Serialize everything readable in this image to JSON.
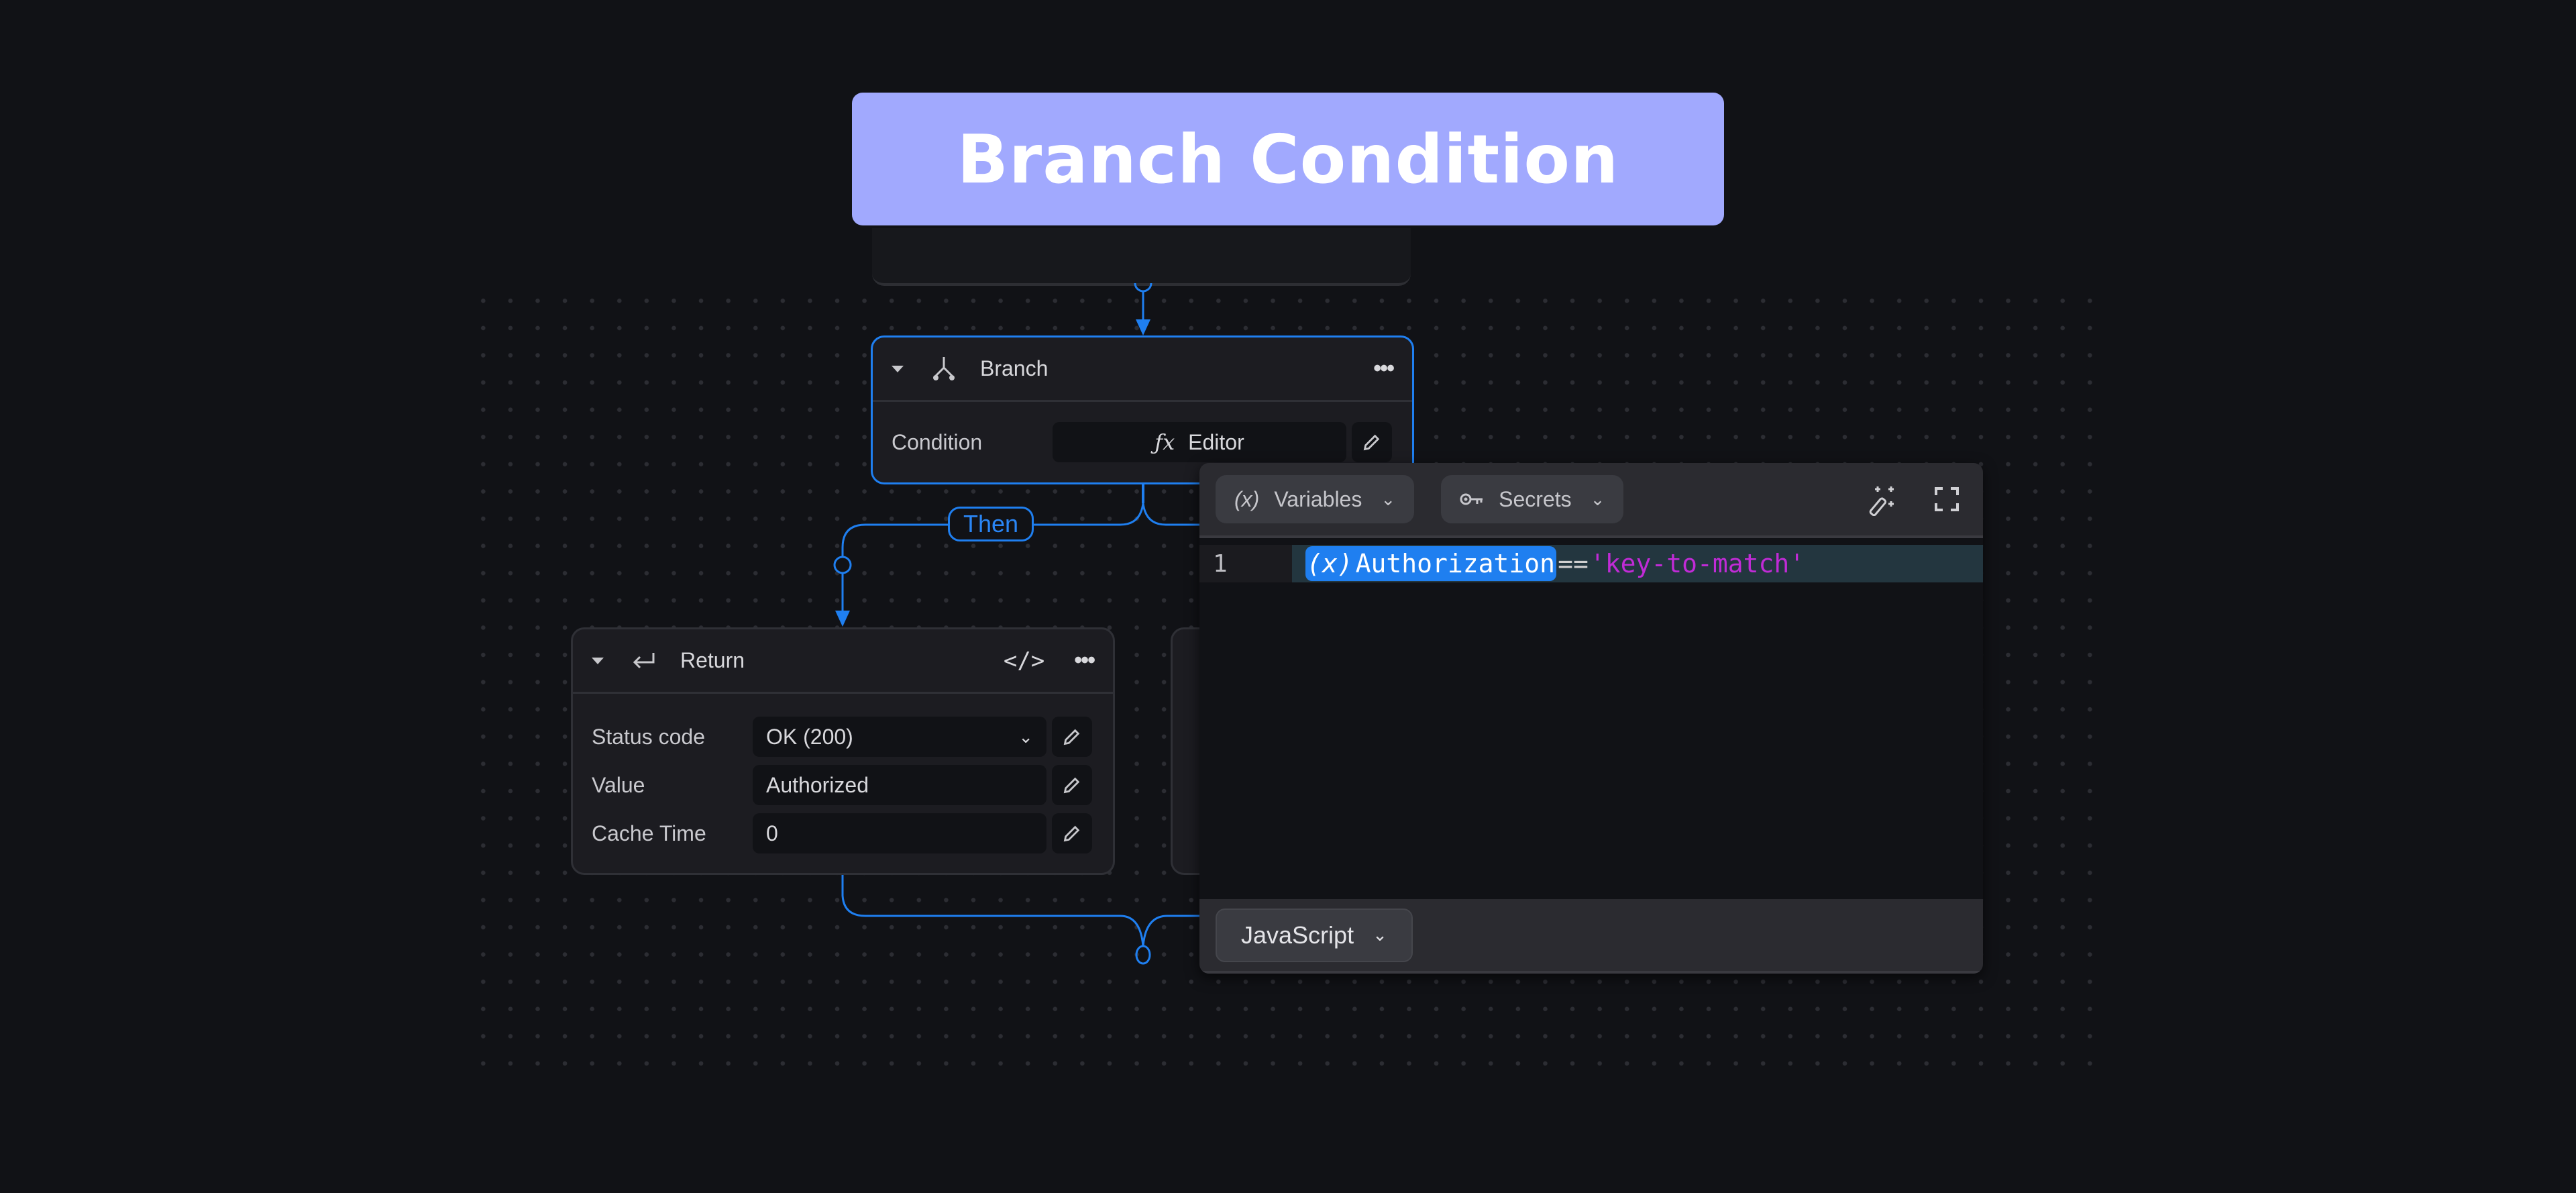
{
  "banner": {
    "title": "Branch Condition"
  },
  "colors": {
    "accent": "#1f7ff0",
    "banner": "#a1a9fe",
    "string": "#c02bd6",
    "background": "#111216"
  },
  "branch_node": {
    "title": "Branch",
    "icon": "branch-icon",
    "condition_label": "Condition",
    "condition_value": "Editor",
    "condition_icon": "function-icon"
  },
  "edge_label": "Then",
  "return_node": {
    "title": "Return",
    "icon": "return-icon",
    "fields": [
      {
        "label": "Status code",
        "value": "OK (200)",
        "type": "select"
      },
      {
        "label": "Value",
        "value": "Authorized",
        "type": "text"
      },
      {
        "label": "Cache Time",
        "value": "0",
        "type": "text"
      }
    ]
  },
  "editor": {
    "variables_label": "Variables",
    "secrets_label": "Secrets",
    "line_number": "1",
    "code": {
      "variable": "Authorization",
      "operator": "==",
      "string": "'key-to-match'"
    },
    "language": "JavaScript"
  }
}
